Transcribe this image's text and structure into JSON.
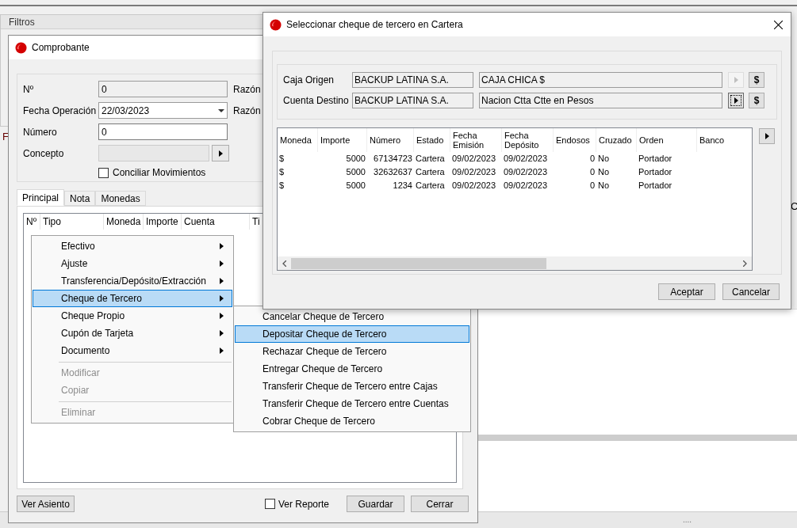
{
  "background": {
    "filters_title": "Filtros",
    "fragments": [
      "F",
      "C"
    ],
    "status_grip": "...."
  },
  "voucher_window": {
    "title": "Comprobante",
    "fields": [
      {
        "label": "Nº",
        "value": "0",
        "kind": "readonly"
      },
      {
        "label": "Fecha Operación",
        "value": "22/03/2023",
        "kind": "date"
      },
      {
        "label": "Número",
        "value": "0",
        "kind": "text"
      },
      {
        "label": "Concepto",
        "kind": "lookup"
      }
    ],
    "side_labels": [
      "Razón",
      "Razón"
    ],
    "reconcile_checkbox": {
      "label": "Conciliar Movimientos",
      "checked": false
    },
    "tabs": [
      {
        "label": "Principal",
        "selected": true
      },
      {
        "label": "Nota",
        "selected": false
      },
      {
        "label": "Monedas",
        "selected": false
      }
    ],
    "grid_columns": [
      "Nº",
      "Tipo",
      "Moneda",
      "Importe",
      "Cuenta",
      "Ti"
    ],
    "entry_button": "Ver Asiento",
    "report_checkbox": {
      "label": "Ver Reporte",
      "checked": false
    },
    "buttons": [
      "Guardar",
      "Cerrar"
    ]
  },
  "context_menu": {
    "items": [
      {
        "kind": "submenu",
        "label": "Efectivo",
        "selected": false,
        "disabled": false
      },
      {
        "kind": "submenu",
        "label": "Ajuste",
        "selected": false,
        "disabled": false
      },
      {
        "kind": "submenu",
        "label": "Transferencia/Depósito/Extracción",
        "selected": false,
        "disabled": false
      },
      {
        "kind": "submenu",
        "label": "Cheque de Tercero",
        "selected": true,
        "disabled": false
      },
      {
        "kind": "submenu",
        "label": "Cheque Propio",
        "selected": false,
        "disabled": false
      },
      {
        "kind": "submenu",
        "label": "Cupón de Tarjeta",
        "selected": false,
        "disabled": false
      },
      {
        "kind": "submenu",
        "label": "Documento",
        "selected": false,
        "disabled": false
      },
      {
        "kind": "separator"
      },
      {
        "kind": "action",
        "label": "Modificar",
        "selected": false,
        "disabled": true
      },
      {
        "kind": "action",
        "label": "Copiar",
        "selected": false,
        "disabled": true
      },
      {
        "kind": "separator"
      },
      {
        "kind": "action",
        "label": "Eliminar",
        "selected": false,
        "disabled": true
      }
    ]
  },
  "submenu": {
    "items": [
      {
        "label": "Cancelar Cheque de Tercero",
        "selected": false
      },
      {
        "label": "Depositar Cheque de Tercero",
        "selected": true
      },
      {
        "label": "Rechazar Cheque de Tercero",
        "selected": false
      },
      {
        "label": "Entregar Cheque de Tercero",
        "selected": false
      },
      {
        "label": "Transferir Cheque de Tercero entre Cajas",
        "selected": false
      },
      {
        "label": "Transferir Cheque de Tercero entre Cuentas",
        "selected": false
      },
      {
        "label": "Cobrar Cheque de Tercero",
        "selected": false
      }
    ]
  },
  "dialog": {
    "title": "Seleccionar cheque de tercero en Cartera",
    "fields": [
      {
        "label": "Caja Origen",
        "company": "BACKUP LATINA S.A.",
        "account": "CAJA CHICA $",
        "lookup_enabled": false,
        "currency_button": "$"
      },
      {
        "label": "Cuenta Destino",
        "company": "BACKUP LATINA S.A.",
        "account": "Nacion Ctta Ctte en Pesos",
        "lookup_enabled": true,
        "currency_button": "$"
      }
    ],
    "columns": [
      {
        "label": "Moneda",
        "numeric": false
      },
      {
        "label": "Importe",
        "numeric": true
      },
      {
        "label": "Número",
        "numeric": true
      },
      {
        "label": "Estado",
        "numeric": false
      },
      {
        "label": "Fecha Emisión",
        "numeric": false
      },
      {
        "label": "Fecha Depósito",
        "numeric": false
      },
      {
        "label": "Endosos",
        "numeric": true
      },
      {
        "label": "Cruzado",
        "numeric": false
      },
      {
        "label": "Orden",
        "numeric": false
      },
      {
        "label": "Banco"
      }
    ],
    "rows": [
      [
        "$",
        "5000",
        "67134723",
        "Cartera",
        "09/02/2023",
        "09/02/2023",
        "0",
        "No",
        "Portador"
      ],
      [
        "$",
        "5000",
        "32632637",
        "Cartera",
        "09/02/2023",
        "09/02/2023",
        "0",
        "No",
        "Portador"
      ],
      [
        "$",
        "5000",
        "1234",
        "Cartera",
        "09/02/2023",
        "09/02/2023",
        "0",
        "No",
        "Portador"
      ]
    ],
    "buttons": [
      "Aceptar",
      "Cancelar"
    ]
  }
}
